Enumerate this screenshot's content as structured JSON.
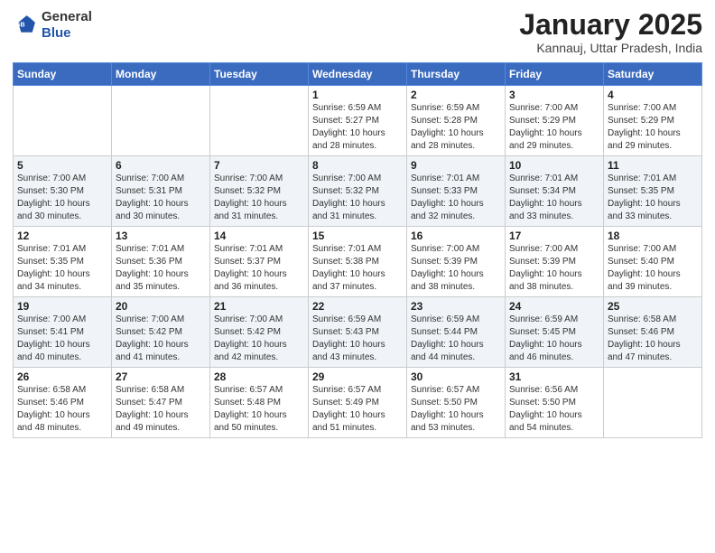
{
  "header": {
    "logo_general": "General",
    "logo_blue": "Blue",
    "month_title": "January 2025",
    "location": "Kannauj, Uttar Pradesh, India"
  },
  "days_of_week": [
    "Sunday",
    "Monday",
    "Tuesday",
    "Wednesday",
    "Thursday",
    "Friday",
    "Saturday"
  ],
  "weeks": [
    [
      {
        "day": "",
        "sunrise": "",
        "sunset": "",
        "daylight": ""
      },
      {
        "day": "",
        "sunrise": "",
        "sunset": "",
        "daylight": ""
      },
      {
        "day": "",
        "sunrise": "",
        "sunset": "",
        "daylight": ""
      },
      {
        "day": "1",
        "sunrise": "Sunrise: 6:59 AM",
        "sunset": "Sunset: 5:27 PM",
        "daylight": "Daylight: 10 hours and 28 minutes."
      },
      {
        "day": "2",
        "sunrise": "Sunrise: 6:59 AM",
        "sunset": "Sunset: 5:28 PM",
        "daylight": "Daylight: 10 hours and 28 minutes."
      },
      {
        "day": "3",
        "sunrise": "Sunrise: 7:00 AM",
        "sunset": "Sunset: 5:29 PM",
        "daylight": "Daylight: 10 hours and 29 minutes."
      },
      {
        "day": "4",
        "sunrise": "Sunrise: 7:00 AM",
        "sunset": "Sunset: 5:29 PM",
        "daylight": "Daylight: 10 hours and 29 minutes."
      }
    ],
    [
      {
        "day": "5",
        "sunrise": "Sunrise: 7:00 AM",
        "sunset": "Sunset: 5:30 PM",
        "daylight": "Daylight: 10 hours and 30 minutes."
      },
      {
        "day": "6",
        "sunrise": "Sunrise: 7:00 AM",
        "sunset": "Sunset: 5:31 PM",
        "daylight": "Daylight: 10 hours and 30 minutes."
      },
      {
        "day": "7",
        "sunrise": "Sunrise: 7:00 AM",
        "sunset": "Sunset: 5:32 PM",
        "daylight": "Daylight: 10 hours and 31 minutes."
      },
      {
        "day": "8",
        "sunrise": "Sunrise: 7:00 AM",
        "sunset": "Sunset: 5:32 PM",
        "daylight": "Daylight: 10 hours and 31 minutes."
      },
      {
        "day": "9",
        "sunrise": "Sunrise: 7:01 AM",
        "sunset": "Sunset: 5:33 PM",
        "daylight": "Daylight: 10 hours and 32 minutes."
      },
      {
        "day": "10",
        "sunrise": "Sunrise: 7:01 AM",
        "sunset": "Sunset: 5:34 PM",
        "daylight": "Daylight: 10 hours and 33 minutes."
      },
      {
        "day": "11",
        "sunrise": "Sunrise: 7:01 AM",
        "sunset": "Sunset: 5:35 PM",
        "daylight": "Daylight: 10 hours and 33 minutes."
      }
    ],
    [
      {
        "day": "12",
        "sunrise": "Sunrise: 7:01 AM",
        "sunset": "Sunset: 5:35 PM",
        "daylight": "Daylight: 10 hours and 34 minutes."
      },
      {
        "day": "13",
        "sunrise": "Sunrise: 7:01 AM",
        "sunset": "Sunset: 5:36 PM",
        "daylight": "Daylight: 10 hours and 35 minutes."
      },
      {
        "day": "14",
        "sunrise": "Sunrise: 7:01 AM",
        "sunset": "Sunset: 5:37 PM",
        "daylight": "Daylight: 10 hours and 36 minutes."
      },
      {
        "day": "15",
        "sunrise": "Sunrise: 7:01 AM",
        "sunset": "Sunset: 5:38 PM",
        "daylight": "Daylight: 10 hours and 37 minutes."
      },
      {
        "day": "16",
        "sunrise": "Sunrise: 7:00 AM",
        "sunset": "Sunset: 5:39 PM",
        "daylight": "Daylight: 10 hours and 38 minutes."
      },
      {
        "day": "17",
        "sunrise": "Sunrise: 7:00 AM",
        "sunset": "Sunset: 5:39 PM",
        "daylight": "Daylight: 10 hours and 38 minutes."
      },
      {
        "day": "18",
        "sunrise": "Sunrise: 7:00 AM",
        "sunset": "Sunset: 5:40 PM",
        "daylight": "Daylight: 10 hours and 39 minutes."
      }
    ],
    [
      {
        "day": "19",
        "sunrise": "Sunrise: 7:00 AM",
        "sunset": "Sunset: 5:41 PM",
        "daylight": "Daylight: 10 hours and 40 minutes."
      },
      {
        "day": "20",
        "sunrise": "Sunrise: 7:00 AM",
        "sunset": "Sunset: 5:42 PM",
        "daylight": "Daylight: 10 hours and 41 minutes."
      },
      {
        "day": "21",
        "sunrise": "Sunrise: 7:00 AM",
        "sunset": "Sunset: 5:42 PM",
        "daylight": "Daylight: 10 hours and 42 minutes."
      },
      {
        "day": "22",
        "sunrise": "Sunrise: 6:59 AM",
        "sunset": "Sunset: 5:43 PM",
        "daylight": "Daylight: 10 hours and 43 minutes."
      },
      {
        "day": "23",
        "sunrise": "Sunrise: 6:59 AM",
        "sunset": "Sunset: 5:44 PM",
        "daylight": "Daylight: 10 hours and 44 minutes."
      },
      {
        "day": "24",
        "sunrise": "Sunrise: 6:59 AM",
        "sunset": "Sunset: 5:45 PM",
        "daylight": "Daylight: 10 hours and 46 minutes."
      },
      {
        "day": "25",
        "sunrise": "Sunrise: 6:58 AM",
        "sunset": "Sunset: 5:46 PM",
        "daylight": "Daylight: 10 hours and 47 minutes."
      }
    ],
    [
      {
        "day": "26",
        "sunrise": "Sunrise: 6:58 AM",
        "sunset": "Sunset: 5:46 PM",
        "daylight": "Daylight: 10 hours and 48 minutes."
      },
      {
        "day": "27",
        "sunrise": "Sunrise: 6:58 AM",
        "sunset": "Sunset: 5:47 PM",
        "daylight": "Daylight: 10 hours and 49 minutes."
      },
      {
        "day": "28",
        "sunrise": "Sunrise: 6:57 AM",
        "sunset": "Sunset: 5:48 PM",
        "daylight": "Daylight: 10 hours and 50 minutes."
      },
      {
        "day": "29",
        "sunrise": "Sunrise: 6:57 AM",
        "sunset": "Sunset: 5:49 PM",
        "daylight": "Daylight: 10 hours and 51 minutes."
      },
      {
        "day": "30",
        "sunrise": "Sunrise: 6:57 AM",
        "sunset": "Sunset: 5:50 PM",
        "daylight": "Daylight: 10 hours and 53 minutes."
      },
      {
        "day": "31",
        "sunrise": "Sunrise: 6:56 AM",
        "sunset": "Sunset: 5:50 PM",
        "daylight": "Daylight: 10 hours and 54 minutes."
      },
      {
        "day": "",
        "sunrise": "",
        "sunset": "",
        "daylight": ""
      }
    ]
  ]
}
